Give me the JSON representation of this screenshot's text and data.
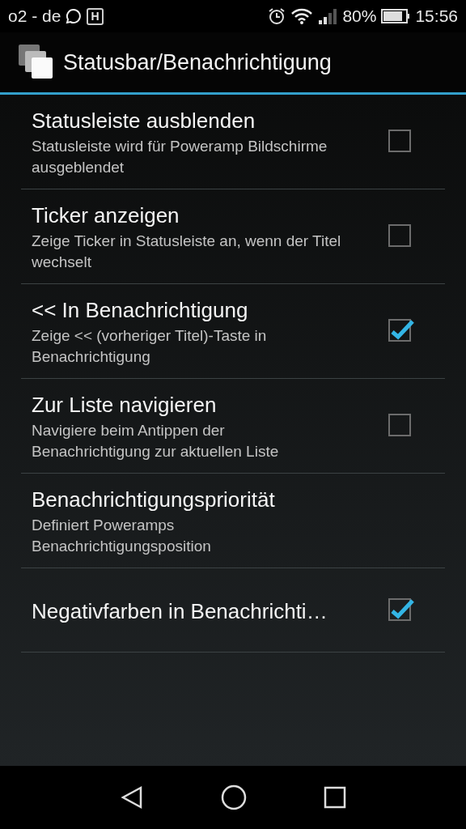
{
  "status_bar": {
    "carrier": "o2 - de",
    "badge": "H",
    "battery": "80%",
    "time": "15:56"
  },
  "action_bar": {
    "title": "Statusbar/Benachrichtigung"
  },
  "preferences": [
    {
      "kind": "checkbox",
      "title": "Statusleiste ausblenden",
      "summary": "Statusleiste wird für Poweramp Bildschirme ausgeblendet",
      "checked": false
    },
    {
      "kind": "checkbox",
      "title": "Ticker anzeigen",
      "summary": "Zeige Ticker in Statusleiste an, wenn der Titel wechselt",
      "checked": false
    },
    {
      "kind": "checkbox",
      "title": "<< In Benachrichtigung",
      "summary": "Zeige << (vorheriger Titel)-Taste in Benachrichtigung",
      "checked": true
    },
    {
      "kind": "checkbox",
      "title": "Zur Liste navigieren",
      "summary": "Navigiere beim Antippen der Benachrichtigung zur aktuellen Liste",
      "checked": false
    },
    {
      "kind": "plain",
      "title": "Benachrichtigungspriorität",
      "summary": "Definiert Poweramps Benachrichtigungsposition"
    },
    {
      "kind": "checkbox",
      "title": "Negativfarben in Benachrichti…",
      "checked": true
    }
  ]
}
